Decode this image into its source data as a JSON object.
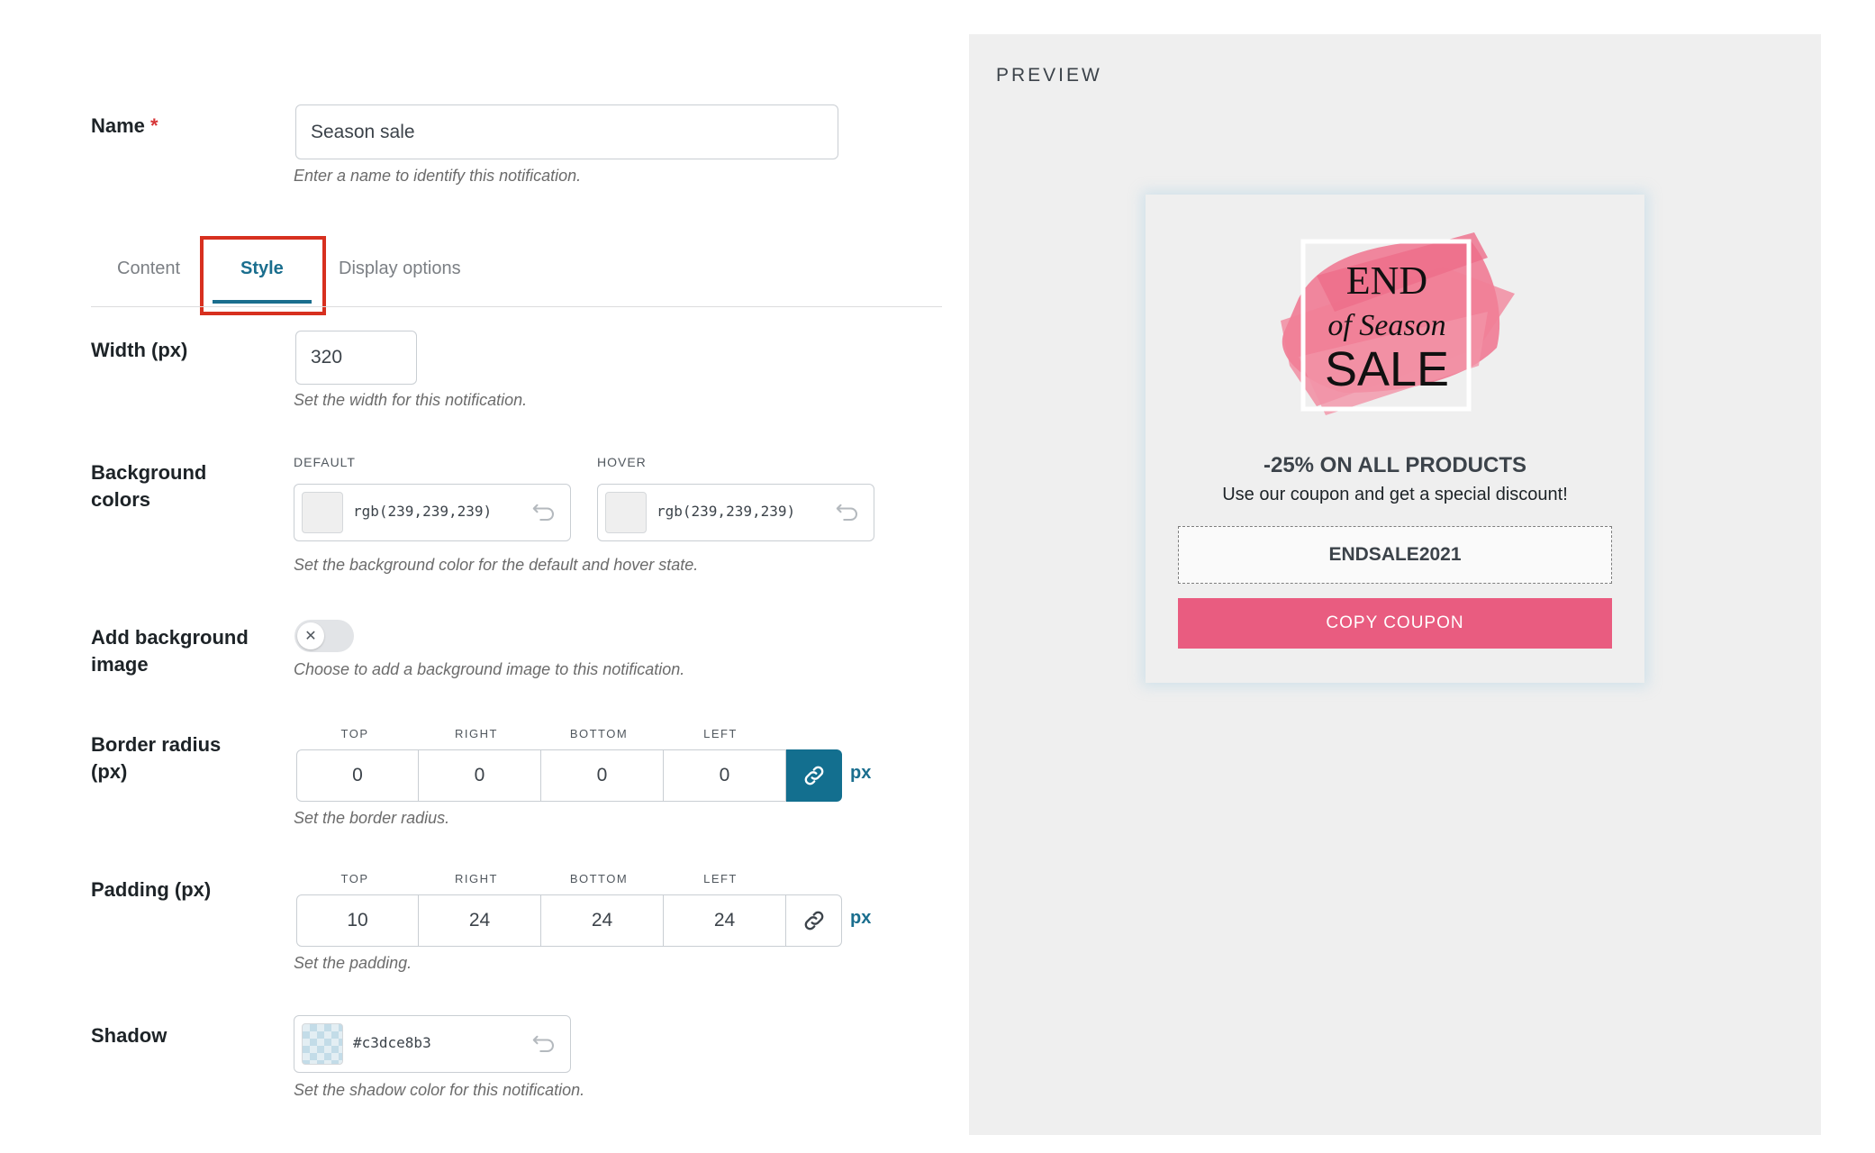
{
  "form": {
    "name": {
      "label": "Name",
      "required_mark": "*",
      "value": "Season sale",
      "help": "Enter a name to identify this notification."
    },
    "tabs": [
      {
        "label": "Content",
        "active": false
      },
      {
        "label": "Style",
        "active": true
      },
      {
        "label": "Display options",
        "active": false
      }
    ],
    "width": {
      "label": "Width (px)",
      "value": "320",
      "help": "Set the width for this notification."
    },
    "bg_colors": {
      "label_line1": "Background",
      "label_line2": "colors",
      "default_label": "DEFAULT",
      "default_value": "rgb(239,239,239)",
      "hover_label": "HOVER",
      "hover_value": "rgb(239,239,239)",
      "help": "Set the background color for the default and hover state.",
      "swatch_color": "#efefef"
    },
    "bg_image": {
      "label_line1": "Add background",
      "label_line2": "image",
      "enabled": false,
      "help": "Choose to add a background image to this notification."
    },
    "border_radius": {
      "label_line1": "Border radius",
      "label_line2": "(px)",
      "sides": [
        {
          "label": "TOP",
          "value": "0"
        },
        {
          "label": "RIGHT",
          "value": "0"
        },
        {
          "label": "BOTTOM",
          "value": "0"
        },
        {
          "label": "LEFT",
          "value": "0"
        }
      ],
      "linked": true,
      "unit": "px",
      "help": "Set the border radius."
    },
    "padding": {
      "label": "Padding (px)",
      "sides": [
        {
          "label": "TOP",
          "value": "10"
        },
        {
          "label": "RIGHT",
          "value": "24"
        },
        {
          "label": "BOTTOM",
          "value": "24"
        },
        {
          "label": "LEFT",
          "value": "24"
        }
      ],
      "linked": false,
      "unit": "px",
      "help": "Set the padding."
    },
    "shadow": {
      "label": "Shadow",
      "value": "#c3dce8b3",
      "help": "Set the shadow color for this notification."
    }
  },
  "preview": {
    "heading": "PREVIEW",
    "card": {
      "logo": {
        "line1": "END",
        "line2": "of Season",
        "line3": "SALE"
      },
      "title": "-25% ON ALL PRODUCTS",
      "subtitle": "Use our coupon and get a special discount!",
      "coupon_code": "ENDSALE2021",
      "button_label": "COPY COUPON"
    }
  },
  "colors": {
    "accent": "#1a6e8e",
    "button": "#e95c80",
    "highlight_box": "#d7301f",
    "preview_bg": "#efefef"
  }
}
